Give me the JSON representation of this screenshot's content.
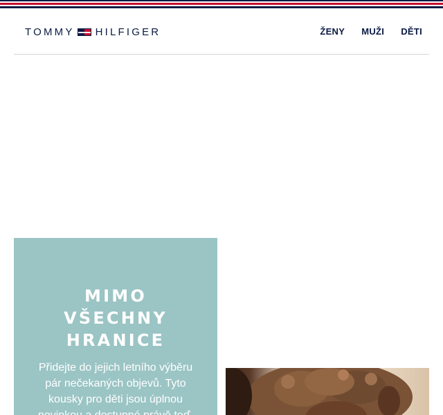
{
  "header": {
    "logo_left": "TOMMY",
    "logo_right": "HILFIGER",
    "nav": [
      {
        "label": "ŽENY"
      },
      {
        "label": "MUŽI"
      },
      {
        "label": "DĚTI"
      }
    ]
  },
  "promo": {
    "title_lines": [
      "MIMO",
      "VŠECHNY",
      "HRANICE"
    ],
    "body": "Přidejte do jejich letního výběru pár nečekaných objevů. Tyto kousky pro děti jsou úplnou novinkou a dostupné právě teď."
  },
  "colors": {
    "brand_navy": "#0b1a44",
    "brand_red": "#c8102e",
    "promo_teal": "#9bc4c4"
  }
}
